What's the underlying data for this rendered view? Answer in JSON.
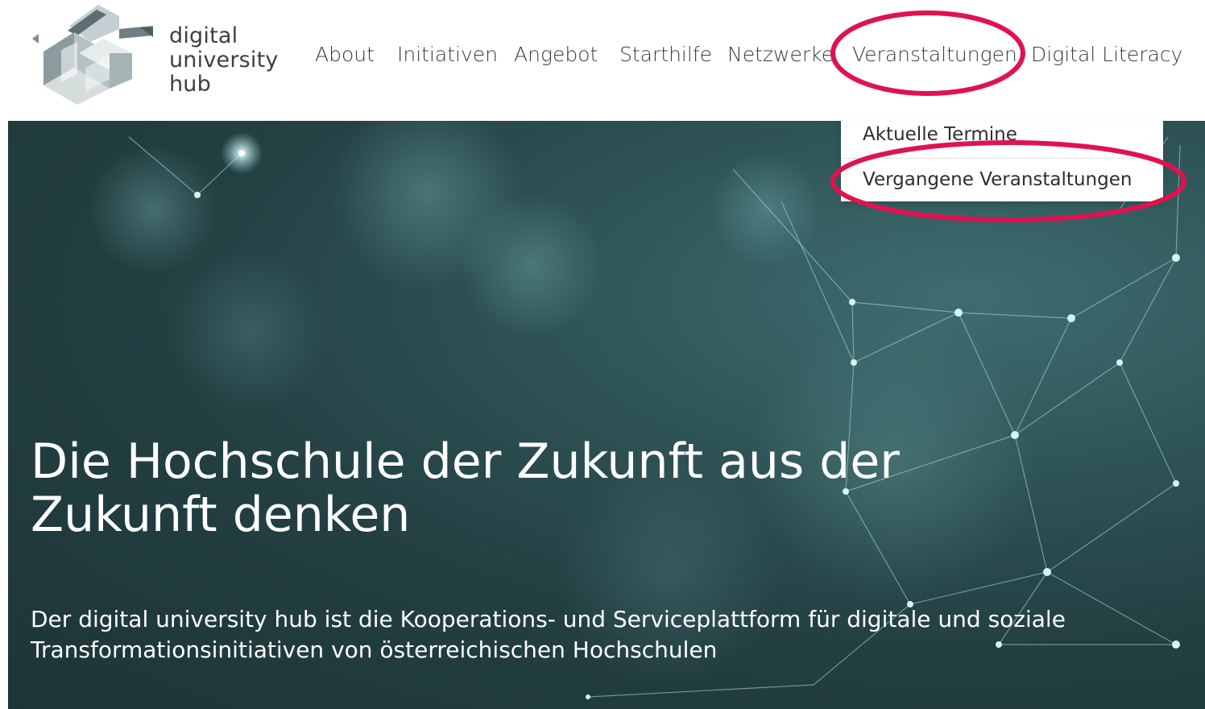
{
  "logo": {
    "line1": "digital",
    "line2": "university",
    "line3": "hub"
  },
  "nav": {
    "items": [
      {
        "label": "About"
      },
      {
        "label": "Initiativen"
      },
      {
        "label": "Angebot"
      },
      {
        "label": "Starthilfe"
      },
      {
        "label": "Netzwerke"
      },
      {
        "label": "Veranstaltungen"
      },
      {
        "label": "Digital Literacy"
      }
    ]
  },
  "dropdown": {
    "items": [
      {
        "label": "Aktuelle Termine"
      },
      {
        "label": "Vergangene Veranstaltungen"
      }
    ]
  },
  "hero": {
    "title": "Die Hochschule der Zukunft aus der Zukunft denken",
    "subtitle": "Der digital university hub ist die Kooperations- und Serviceplattform für digitale und soziale Transformationsinitiativen von österreichischen Hochschulen"
  },
  "colors": {
    "annotation": "#e0124f",
    "hero_bg": "#2a4a4d",
    "nav_text": "#3c3c3c"
  }
}
